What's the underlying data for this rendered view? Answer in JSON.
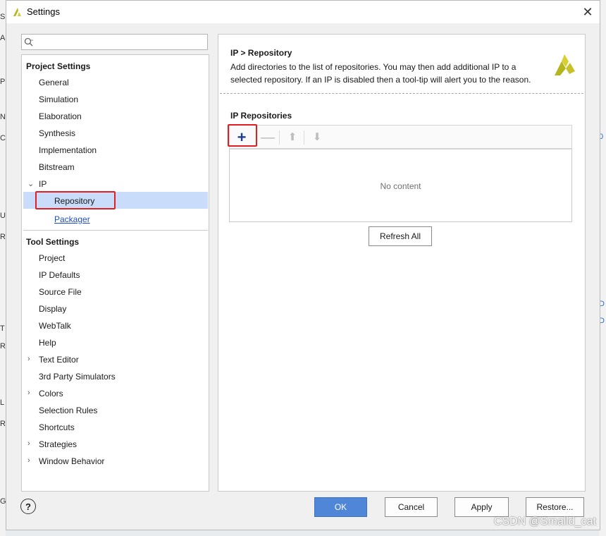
{
  "window": {
    "title": "Settings",
    "close_glyph": "✕"
  },
  "search": {
    "placeholder": "",
    "value": ""
  },
  "tree": {
    "project_settings_header": "Project Settings",
    "project_items": [
      "General",
      "Simulation",
      "Elaboration",
      "Synthesis",
      "Implementation",
      "Bitstream"
    ],
    "ip_label": "IP",
    "ip_children": [
      "Repository",
      "Packager"
    ],
    "selected_item": "Repository",
    "tool_settings_header": "Tool Settings",
    "tool_items": [
      "Project",
      "IP Defaults",
      "Source File",
      "Display",
      "WebTalk",
      "Help",
      "Text Editor",
      "3rd Party Simulators",
      "Colors",
      "Selection Rules",
      "Shortcuts",
      "Strategies",
      "Window Behavior"
    ],
    "collapsed_groups": [
      "Text Editor",
      "Colors",
      "Strategies",
      "Window Behavior"
    ]
  },
  "panel": {
    "breadcrumb": "IP > Repository",
    "description": "Add directories to the list of repositories. You may then add additional IP to a selected repository. If an IP is disabled then a tool-tip will alert you to the reason.",
    "section_title": "IP Repositories",
    "toolbar": {
      "add": "+",
      "remove": "—",
      "up": "⬆",
      "down": "⬇"
    },
    "empty_text": "No content",
    "refresh_label": "Refresh All"
  },
  "footer": {
    "help_glyph": "?",
    "ok_label": "OK",
    "cancel_label": "Cancel",
    "apply_label": "Apply",
    "restore_label": "Restore..."
  },
  "watermark": "CSDN @Smalld_cat",
  "colors": {
    "accent": "#4f86d8",
    "selection": "#c9dcf9",
    "highlight_box": "#e02020",
    "logo": "#b5b51e"
  }
}
